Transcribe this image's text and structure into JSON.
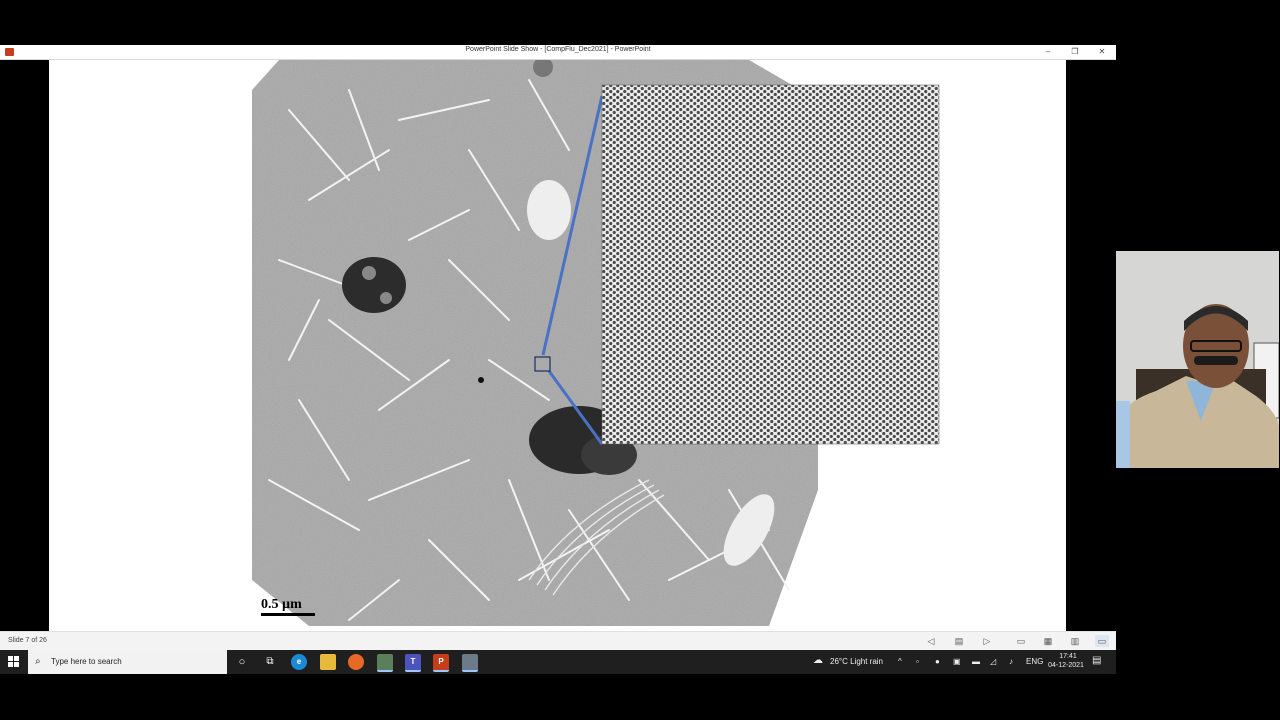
{
  "window": {
    "title": "PowerPoint Slide Show - [CompFlu_Dec2021] - PowerPoint",
    "controls": {
      "minimize": "–",
      "restore": "❐",
      "close": "✕"
    }
  },
  "slide": {
    "scale_bar_label": "0.5 µm",
    "colors": {
      "zoom_outline": "#4a72c4"
    }
  },
  "statusbar": {
    "slide_counter": "Slide 7 of 26",
    "icons": [
      "previous-slide-icon",
      "slide-list-icon",
      "next-slide-icon",
      "normal-view-icon",
      "slide-sorter-icon",
      "reading-view-icon",
      "slideshow-icon"
    ]
  },
  "taskbar": {
    "search_placeholder": "Type here to search",
    "apps": [
      "cortana-icon",
      "task-view-icon",
      "edge-icon",
      "file-explorer-icon",
      "firefox-icon",
      "app-icon",
      "teams-icon",
      "powerpoint-icon",
      "app2-icon"
    ],
    "weather": "26°C  Light rain",
    "language": "ENG",
    "time": "17:41",
    "date": "04-12-2021"
  }
}
